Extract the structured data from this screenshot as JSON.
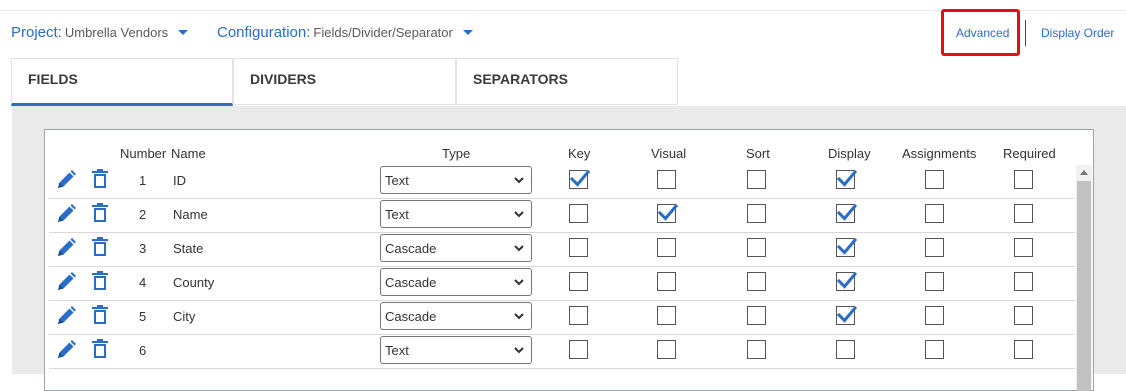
{
  "header": {
    "project_label": "Project:",
    "project_value": "Umbrella Vendors",
    "configuration_label": "Configuration:",
    "configuration_value": "Fields/Divider/Separator",
    "advanced_label": "Advanced",
    "display_order_label": "Display Order",
    "highlight_color": "#e0101a"
  },
  "tabs": [
    {
      "label": "FIELDS",
      "active": true
    },
    {
      "label": "DIVIDERS",
      "active": false
    },
    {
      "label": "SEPARATORS",
      "active": false
    }
  ],
  "table": {
    "columns": {
      "number": "Number",
      "name": "Name",
      "type": "Type",
      "key": "Key",
      "visual": "Visual",
      "sort": "Sort",
      "display": "Display",
      "assignments": "Assignments",
      "required": "Required"
    },
    "rows": [
      {
        "number": "1",
        "name": "ID",
        "type": "Text",
        "key": true,
        "visual": false,
        "sort": false,
        "display": true,
        "assignments": false,
        "required": false
      },
      {
        "number": "2",
        "name": "Name",
        "type": "Text",
        "key": false,
        "visual": true,
        "sort": false,
        "display": true,
        "assignments": false,
        "required": false
      },
      {
        "number": "3",
        "name": "State",
        "type": "Cascade",
        "key": false,
        "visual": false,
        "sort": false,
        "display": true,
        "assignments": false,
        "required": false
      },
      {
        "number": "4",
        "name": "County",
        "type": "Cascade",
        "key": false,
        "visual": false,
        "sort": false,
        "display": true,
        "assignments": false,
        "required": false
      },
      {
        "number": "5",
        "name": "City",
        "type": "Cascade",
        "key": false,
        "visual": false,
        "sort": false,
        "display": true,
        "assignments": false,
        "required": false
      },
      {
        "number": "6",
        "name": "",
        "type": "Text",
        "key": false,
        "visual": false,
        "sort": false,
        "display": false,
        "assignments": false,
        "required": false
      }
    ]
  },
  "icons": {
    "edit": "pencil-icon",
    "delete": "trash-icon",
    "dropdown": "chevron-down-icon"
  },
  "colors": {
    "accent": "#2a6dc7",
    "check": "#2a6dc7"
  }
}
